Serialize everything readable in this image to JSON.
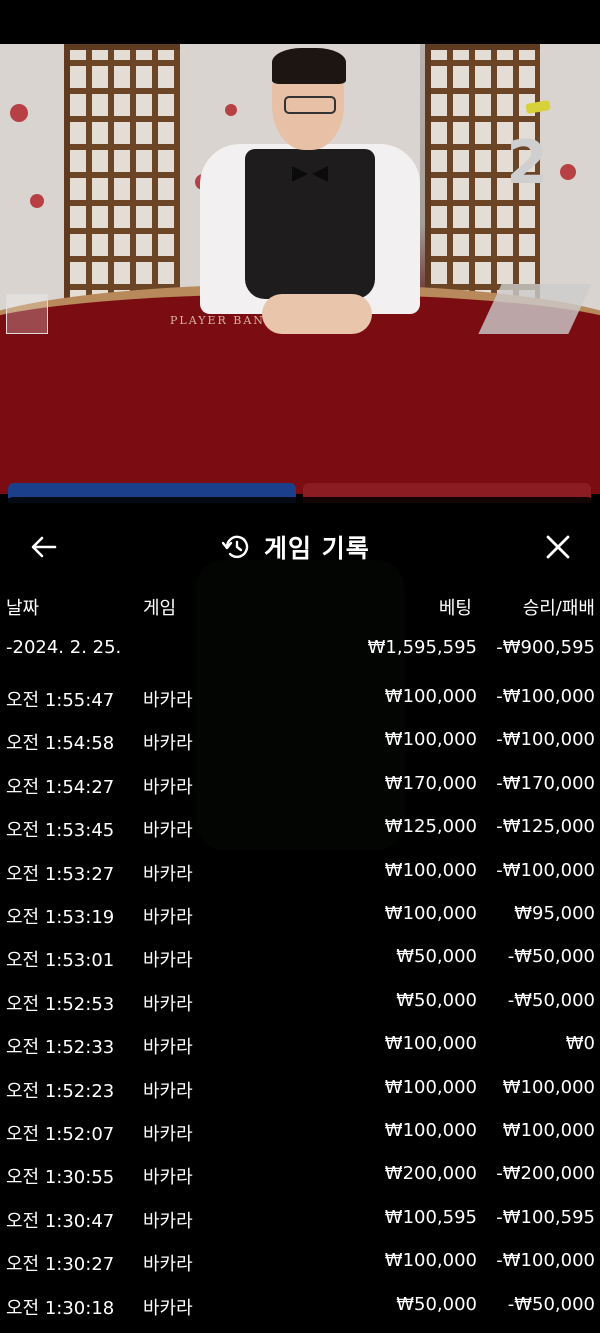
{
  "video": {
    "round_number": "2",
    "table_felt_text": "PLAYER   BANKER"
  },
  "header": {
    "title": "게임 기록",
    "back_icon": "arrow-left-icon",
    "history_icon": "history-icon",
    "close_icon": "close-icon"
  },
  "columns": {
    "date": "날짜",
    "game": "게임",
    "bet": "베팅",
    "result": "승리/패배"
  },
  "summary": {
    "date": "-2024. 2. 25.",
    "bet": "₩1,595,595",
    "result": "-₩900,595"
  },
  "rows": [
    {
      "time": "오전 1:55:47",
      "game": "바카라",
      "bet": "₩100,000",
      "result": "-₩100,000"
    },
    {
      "time": "오전 1:54:58",
      "game": "바카라",
      "bet": "₩100,000",
      "result": "-₩100,000"
    },
    {
      "time": "오전 1:54:27",
      "game": "바카라",
      "bet": "₩170,000",
      "result": "-₩170,000"
    },
    {
      "time": "오전 1:53:45",
      "game": "바카라",
      "bet": "₩125,000",
      "result": "-₩125,000"
    },
    {
      "time": "오전 1:53:27",
      "game": "바카라",
      "bet": "₩100,000",
      "result": "-₩100,000"
    },
    {
      "time": "오전 1:53:19",
      "game": "바카라",
      "bet": "₩100,000",
      "result": "₩95,000"
    },
    {
      "time": "오전 1:53:01",
      "game": "바카라",
      "bet": "₩50,000",
      "result": "-₩50,000"
    },
    {
      "time": "오전 1:52:53",
      "game": "바카라",
      "bet": "₩50,000",
      "result": "-₩50,000"
    },
    {
      "time": "오전 1:52:33",
      "game": "바카라",
      "bet": "₩100,000",
      "result": "₩0"
    },
    {
      "time": "오전 1:52:23",
      "game": "바카라",
      "bet": "₩100,000",
      "result": "₩100,000"
    },
    {
      "time": "오전 1:52:07",
      "game": "바카라",
      "bet": "₩100,000",
      "result": "₩100,000"
    },
    {
      "time": "오전 1:30:55",
      "game": "바카라",
      "bet": "₩200,000",
      "result": "-₩200,000"
    },
    {
      "time": "오전 1:30:47",
      "game": "바카라",
      "bet": "₩100,595",
      "result": "-₩100,595"
    },
    {
      "time": "오전 1:30:27",
      "game": "바카라",
      "bet": "₩100,000",
      "result": "-₩100,000"
    },
    {
      "time": "오전 1:30:18",
      "game": "바카라",
      "bet": "₩50,000",
      "result": "-₩50,000"
    }
  ]
}
